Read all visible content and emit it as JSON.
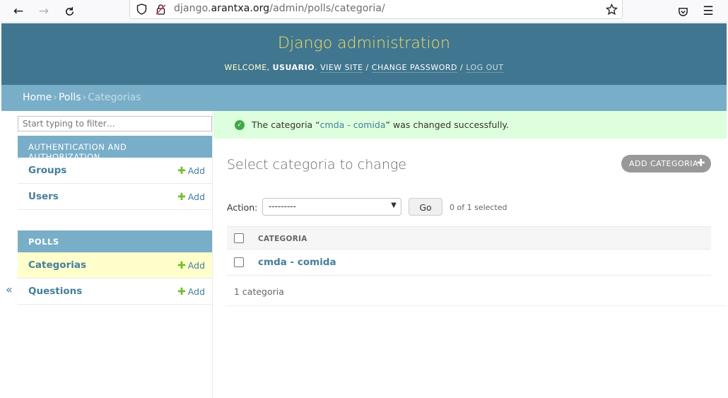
{
  "browser": {
    "url_prefix": "django.",
    "url_host": "arantxa.org",
    "url_path": "/admin/polls/categoria/"
  },
  "header": {
    "branding": "Django administration",
    "welcome": "WELCOME,",
    "username": "USUARIO",
    "view_site": "VIEW SITE",
    "change_password": "CHANGE PASSWORD",
    "log_out": "LOG OUT"
  },
  "breadcrumbs": {
    "home": "Home",
    "app": "Polls",
    "current": "Categorias"
  },
  "sidebar": {
    "filter_placeholder": "Start typing to filter…",
    "collapse": "«",
    "modules": [
      {
        "caption": "Authentication and Authorization",
        "models": [
          {
            "name": "Groups",
            "add": "Add"
          },
          {
            "name": "Users",
            "add": "Add"
          }
        ]
      },
      {
        "caption": "Polls",
        "models": [
          {
            "name": "Categorias",
            "add": "Add"
          },
          {
            "name": "Questions",
            "add": "Add"
          }
        ]
      }
    ]
  },
  "message": {
    "pre": "The categoria “",
    "link": "cmda - comida",
    "post": "” was changed successfully."
  },
  "content": {
    "title": "Select categoria to change",
    "add_button": "ADD CATEGORIA",
    "action_label": "Action:",
    "action_selected": "---------",
    "go": "Go",
    "selected_count": "0 of 1 selected",
    "column_header": "CATEGORIA",
    "rows": [
      "cmda - comida"
    ],
    "paginator": "1 categoria"
  },
  "colors": {
    "header_bg": "#417690",
    "branding": "#f5dd5d",
    "breadcrumb_bg": "#79aec8",
    "link": "#447e9b",
    "success_bg": "#dfd",
    "add_green": "#70bf2b"
  }
}
